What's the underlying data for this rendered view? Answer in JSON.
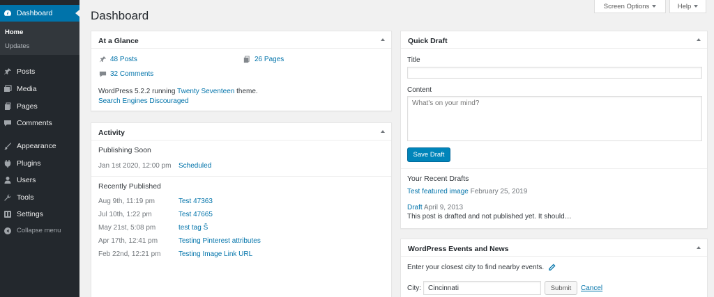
{
  "sidebar": {
    "dashboard_label": "Dashboard",
    "submenu": {
      "home": "Home",
      "updates": "Updates"
    },
    "items": [
      {
        "label": "Posts",
        "icon": "pin-icon"
      },
      {
        "label": "Media",
        "icon": "media-icon"
      },
      {
        "label": "Pages",
        "icon": "pages-icon"
      },
      {
        "label": "Comments",
        "icon": "comment-icon"
      },
      {
        "label": "Appearance",
        "icon": "brush-icon"
      },
      {
        "label": "Plugins",
        "icon": "plugin-icon"
      },
      {
        "label": "Users",
        "icon": "users-icon"
      },
      {
        "label": "Tools",
        "icon": "wrench-icon"
      },
      {
        "label": "Settings",
        "icon": "settings-icon"
      },
      {
        "label": "Collapse menu",
        "icon": "collapse-icon"
      }
    ]
  },
  "header": {
    "title": "Dashboard",
    "screen_options": "Screen Options",
    "help": "Help"
  },
  "at_a_glance": {
    "title": "At a Glance",
    "posts": "48 Posts",
    "pages": "26 Pages",
    "comments": "32 Comments",
    "wp_text_before": "WordPress 5.2.2 running",
    "theme": "Twenty Seventeen",
    "wp_text_after": "theme.",
    "search_engines": "Search Engines Discouraged"
  },
  "activity": {
    "title": "Activity",
    "publishing_soon": "Publishing Soon",
    "scheduled": [
      {
        "date": "Jan 1st 2020, 12:00 pm",
        "title": "Scheduled"
      }
    ],
    "recently_published": "Recently Published",
    "published": [
      {
        "date": "Aug 9th, 11:19 pm",
        "title": "Test 47363"
      },
      {
        "date": "Jul 10th, 1:22 pm",
        "title": "Test 47665"
      },
      {
        "date": "May 21st, 5:08 pm",
        "title": "test tag Š"
      },
      {
        "date": "Apr 17th, 12:41 pm",
        "title": "Testing Pinterest attributes"
      },
      {
        "date": "Feb 22nd, 12:21 pm",
        "title": "Testing Image Link URL"
      }
    ]
  },
  "quick_draft": {
    "title": "Quick Draft",
    "title_label": "Title",
    "title_value": "",
    "content_label": "Content",
    "content_placeholder": "What's on your mind?",
    "save_button": "Save Draft",
    "recent_heading": "Your Recent Drafts",
    "drafts": [
      {
        "title": "Test featured image",
        "date": "February 25, 2019"
      },
      {
        "title": "Draft",
        "date": "April 9, 2013",
        "excerpt": "This post is drafted and not published yet. It should…"
      }
    ]
  },
  "events": {
    "title": "WordPress Events and News",
    "prompt": "Enter your closest city to find nearby events.",
    "city_label": "City:",
    "city_value": "Cincinnati",
    "submit": "Submit",
    "cancel": "Cancel"
  },
  "colors": {
    "sidebar_bg": "#23282d",
    "accent": "#0073aa",
    "primary_button": "#0085ba",
    "page_bg": "#f1f1f1"
  }
}
